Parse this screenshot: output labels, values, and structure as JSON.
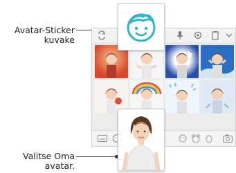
{
  "callouts": {
    "sticker_label_line1": "Avatar-Sticker",
    "sticker_label_line2": "kuvake",
    "avatar_label_line1": "Valitse Oma",
    "avatar_label_line2": "avatar."
  },
  "toolbar": {
    "icons": [
      "switch-keyboard-icon",
      "avatar-sticker-icon",
      "microphone-icon",
      "settings-icon",
      "clipboard-icon",
      "collapse-icon"
    ]
  },
  "bottombar": {
    "icons": [
      "keyboard-icon",
      "avatar-icon",
      "emoji-icon",
      "camera-icon"
    ]
  },
  "colors": {
    "accent": "#2ab7c9",
    "panel_bg": "#ececec",
    "line": "#444444"
  }
}
